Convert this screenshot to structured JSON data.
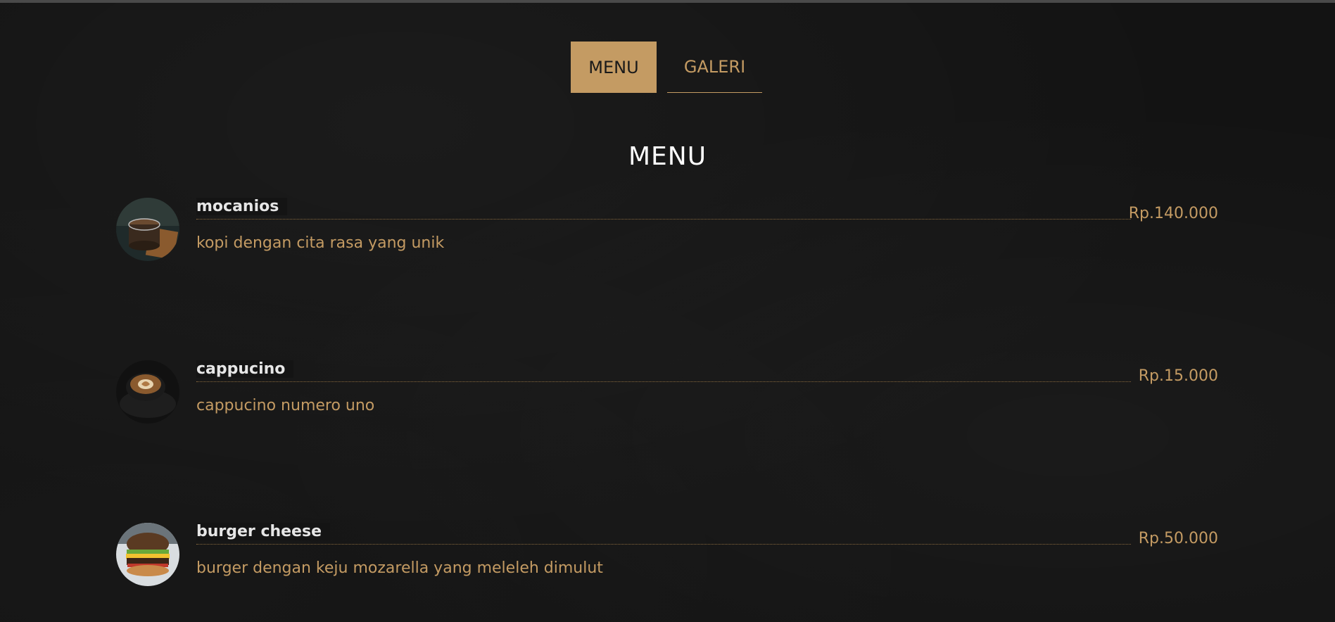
{
  "tabs": {
    "menu_label": "MENU",
    "galeri_label": "GALERI"
  },
  "section": {
    "title": "MENU"
  },
  "items": [
    {
      "name": "mocanios",
      "price": "Rp.140.000",
      "description": "kopi dengan cita rasa yang unik",
      "image": "iced-coffee-photo"
    },
    {
      "name": "cappucino",
      "price": "Rp.15.000",
      "description": "cappucino numero uno",
      "image": "cappuccino-photo"
    },
    {
      "name": "burger cheese",
      "price": "Rp.50.000",
      "description": "burger dengan keju mozarella yang meleleh dimulut",
      "image": "burger-photo"
    }
  ],
  "colors": {
    "accent": "#c49b63",
    "background": "#131313",
    "title": "#ffffff"
  }
}
